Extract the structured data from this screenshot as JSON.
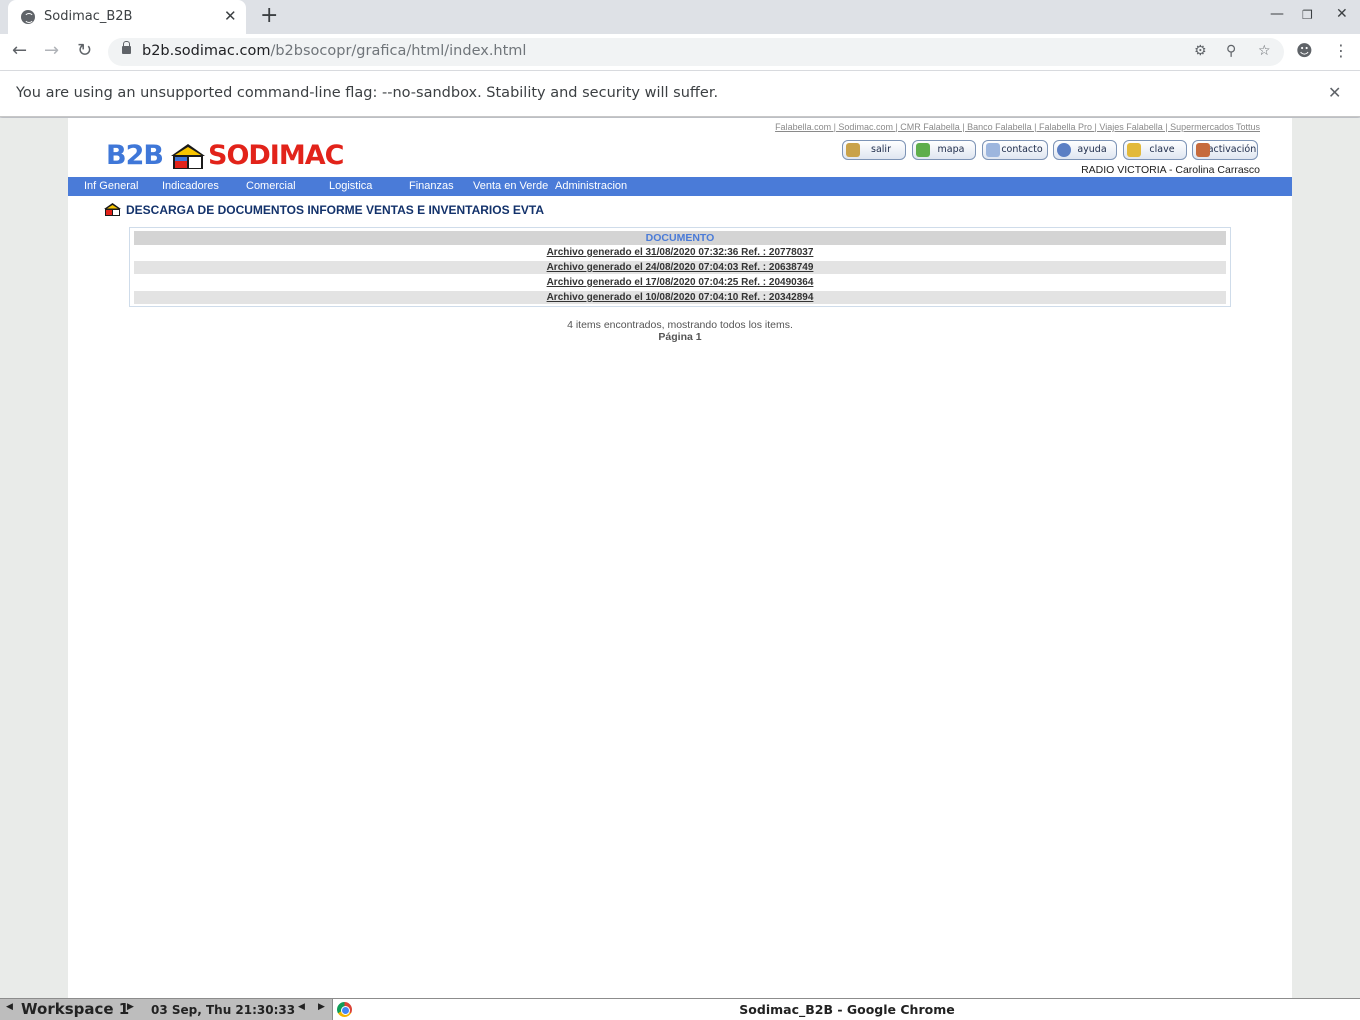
{
  "browser": {
    "tab_title": "Sodimac_B2B",
    "tab_close": "✕",
    "new_tab": "+",
    "url_host": "b2b.sodimac.com",
    "url_path": "/b2bsocopr/grafica/html/index.html",
    "infobar_message": "You are using an unsupported command-line flag: --no-sandbox. Stability and security will suffer.",
    "infobar_close": "✕"
  },
  "site": {
    "top_links": "Falabella.com | Sodimac.com | CMR Falabella | Banco Falabella | Falabella Pro | Viajes Falabella | Supermercados Tottus",
    "logo_b2b": "B2B",
    "logo_brand": "SODIMAC",
    "header_buttons": [
      {
        "label": "salir",
        "icon": "door-icon"
      },
      {
        "label": "mapa",
        "icon": "sitemap-icon"
      },
      {
        "label": "contacto",
        "icon": "envelope-icon"
      },
      {
        "label": "ayuda",
        "icon": "help-icon"
      },
      {
        "label": "clave",
        "icon": "key-icon"
      },
      {
        "label": "activación",
        "icon": "user-activation-icon"
      }
    ],
    "user": "RADIO VICTORIA - Carolina Carrasco",
    "menu": [
      "Inf General",
      "Indicadores",
      "Comercial",
      "Logistica",
      "Finanzas",
      "Venta en Verde",
      "Administracion"
    ],
    "page_title": "DESCARGA DE DOCUMENTOS INFORME VENTAS E INVENTARIOS EVTA",
    "table_header": "DOCUMENTO",
    "documents": [
      "Archivo generado el 31/08/2020 07:32:36  Ref. : 20778037",
      "Archivo generado el 24/08/2020 07:04:03  Ref. : 20638749",
      "Archivo generado el 17/08/2020 07:04:25  Ref. : 20490364",
      "Archivo generado el 10/08/2020 07:04:10  Ref. : 20342894"
    ],
    "found_text": "4 items encontrados, mostrando todos los items.",
    "page_text": "Página 1"
  },
  "taskbar": {
    "workspace": "Workspace 1",
    "clock": "03 Sep, Thu 21:30:33",
    "window_title": "Sodimac_B2B - Google Chrome"
  },
  "colors": {
    "menu_bar": "#4a7bd8",
    "brand_blue": "#3f77d8",
    "brand_red": "#e2231a",
    "title_navy": "#13326b"
  }
}
